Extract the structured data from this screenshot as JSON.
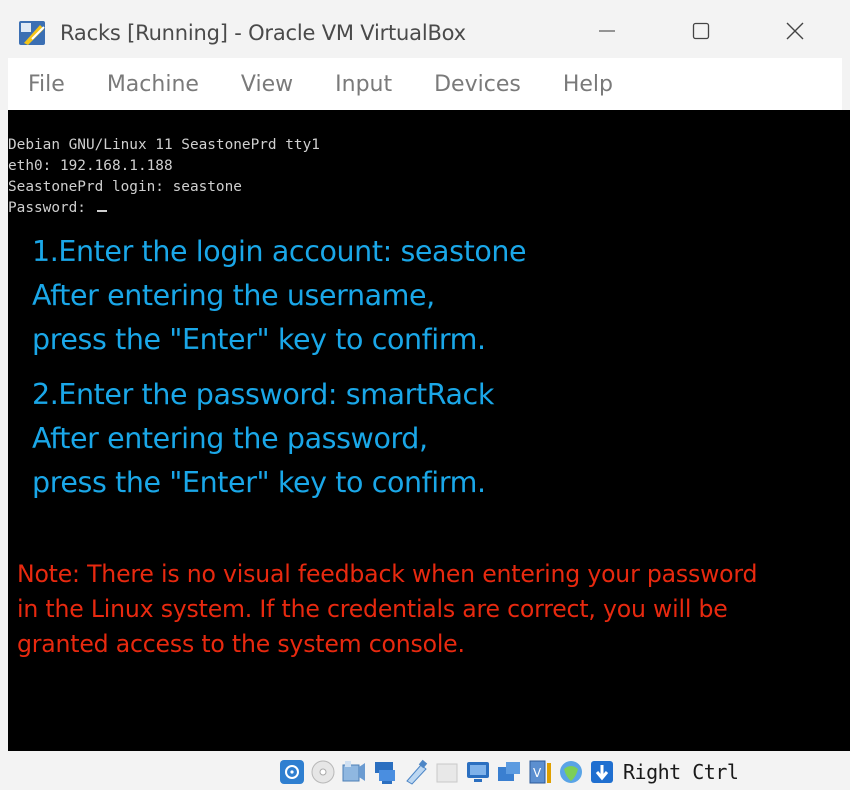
{
  "window": {
    "title": "Racks [Running] - Oracle VM VirtualBox",
    "controls": {
      "minimize": "—",
      "maximize": "☐",
      "close": "✕"
    }
  },
  "menu": [
    {
      "label": "File"
    },
    {
      "label": "Machine"
    },
    {
      "label": "View"
    },
    {
      "label": "Input"
    },
    {
      "label": "Devices"
    },
    {
      "label": "Help"
    }
  ],
  "console": {
    "tty_lines": [
      "Debian GNU/Linux 11 SeastonePrd tty1",
      "eth0: 192.168.1.188",
      "SeastonePrd login: seastone",
      "Password: "
    ],
    "step1": [
      "1.Enter the login account: seastone",
      "After entering the username,",
      "press the \"Enter\" key to confirm."
    ],
    "step2": [
      "2.Enter the password: smartRack",
      "After entering the password,",
      "press the \"Enter\" key to confirm."
    ],
    "note": [
      "Note: There is no visual feedback when entering your password",
      "in the Linux system. If the credentials are correct, you will be",
      "granted access to the system console."
    ]
  },
  "statusbar": {
    "icons": [
      "hard-disk-icon",
      "optical-drive-icon",
      "audio-icon",
      "network-icon",
      "usb-icon",
      "shared-folders-icon",
      "display-icon",
      "recording-icon",
      "cpu-icon",
      "guest-additions-icon",
      "mouse-integration-icon"
    ],
    "host_key": "Right Ctrl"
  },
  "colors": {
    "instruction_text": "#1aa7e8",
    "note_text": "#e8290f",
    "console_bg": "#000000"
  }
}
